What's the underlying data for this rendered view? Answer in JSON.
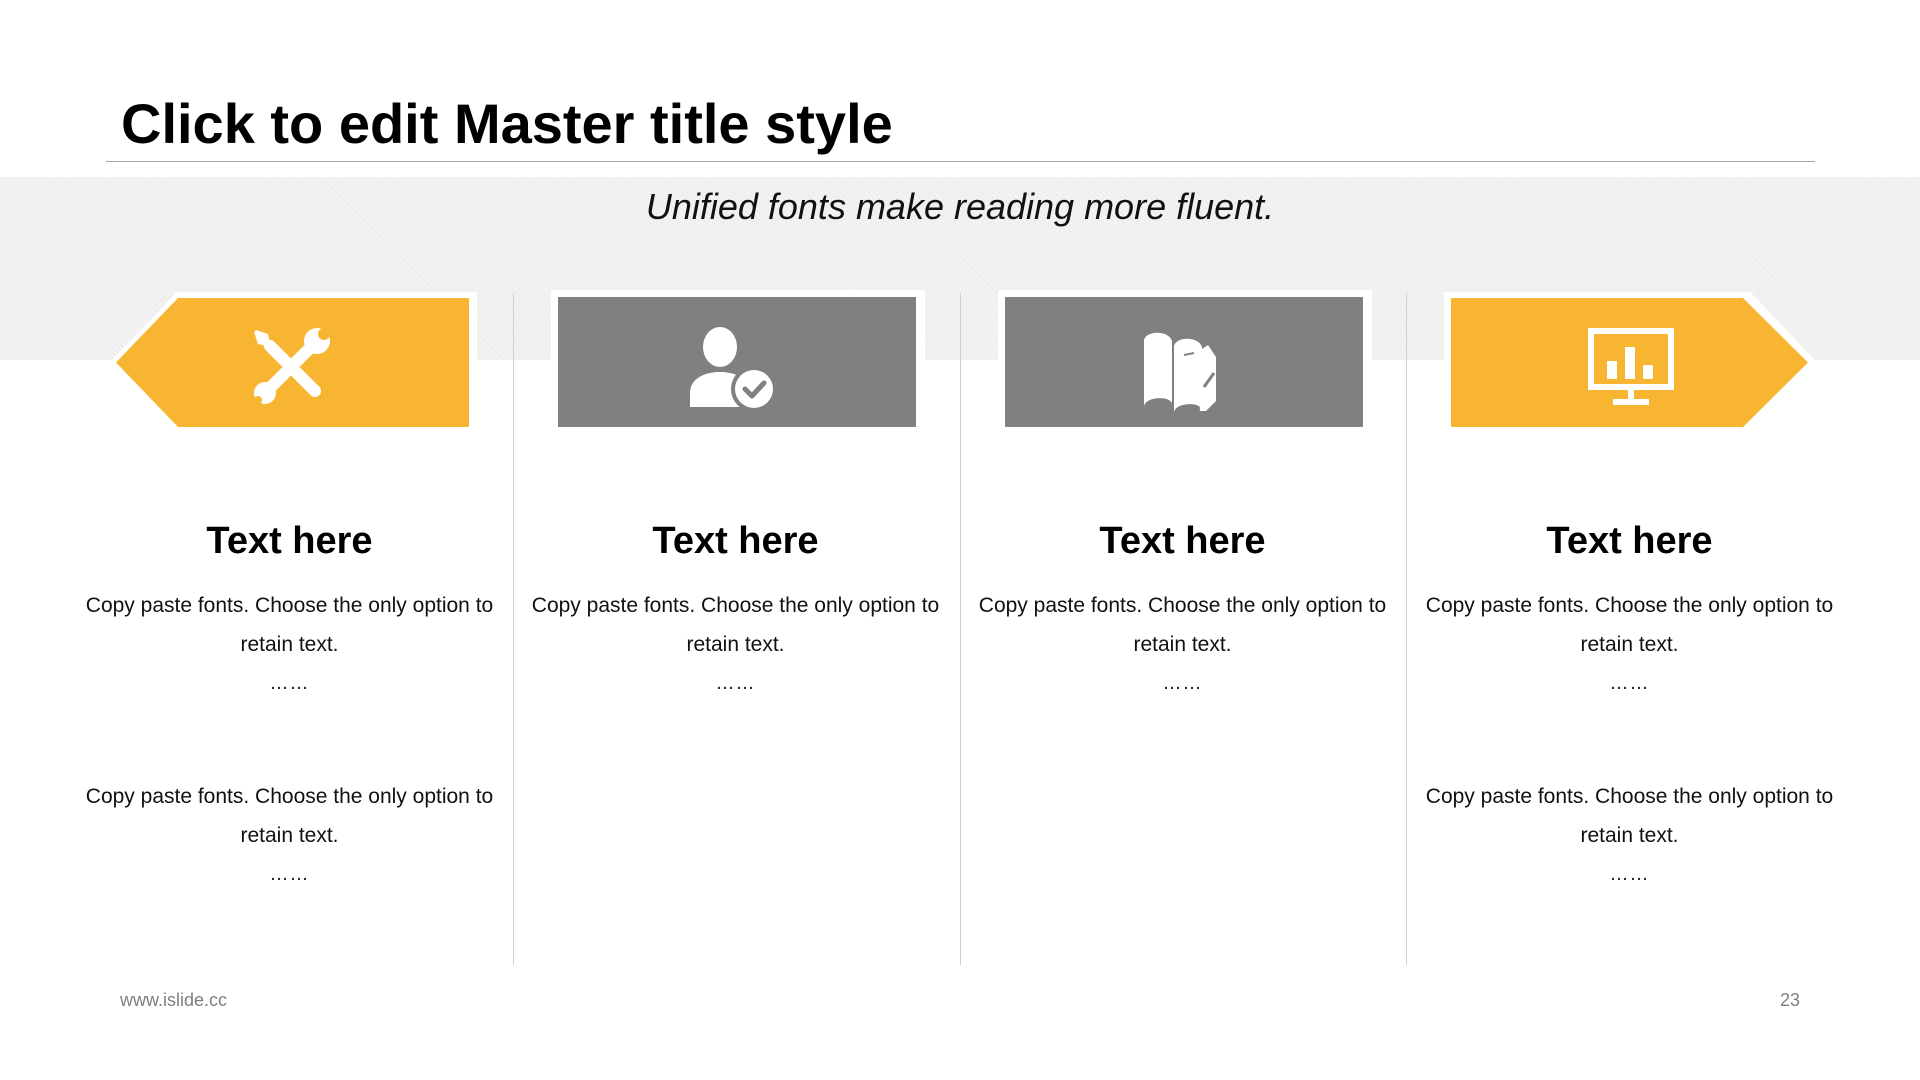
{
  "slide": {
    "title": "Click to edit Master title style",
    "subtitle": "Unified fonts make reading more fluent.",
    "footer_url": "www.islide.cc",
    "page_number": "23"
  },
  "colors": {
    "accent": "#F8B532",
    "neutral": "#808080",
    "band": "#F2F2F2",
    "divider": "#CFCFCF",
    "footer_text": "#7F7F7F"
  },
  "columns": [
    {
      "icon": "tools-icon",
      "banner_color": "#F8B532",
      "heading": "Text here",
      "blocks": [
        {
          "text": "Copy paste fonts. Choose the only option to retain text.",
          "dots": "……"
        },
        {
          "text": "Copy paste fonts. Choose the only option to retain text.",
          "dots": "……"
        }
      ]
    },
    {
      "icon": "user-check-icon",
      "banner_color": "#808080",
      "heading": "Text here",
      "blocks": [
        {
          "text": "Copy paste fonts. Choose the only option to retain text.",
          "dots": "……"
        }
      ]
    },
    {
      "icon": "books-icon",
      "banner_color": "#808080",
      "heading": "Text here",
      "blocks": [
        {
          "text": "Copy paste fonts. Choose the only option to retain text.",
          "dots": "……"
        }
      ]
    },
    {
      "icon": "presentation-chart-icon",
      "banner_color": "#F8B532",
      "heading": "Text here",
      "blocks": [
        {
          "text": "Copy paste fonts. Choose the only option to retain text.",
          "dots": "……"
        },
        {
          "text": "Copy paste fonts. Choose the only option to retain text.",
          "dots": "……"
        }
      ]
    }
  ]
}
